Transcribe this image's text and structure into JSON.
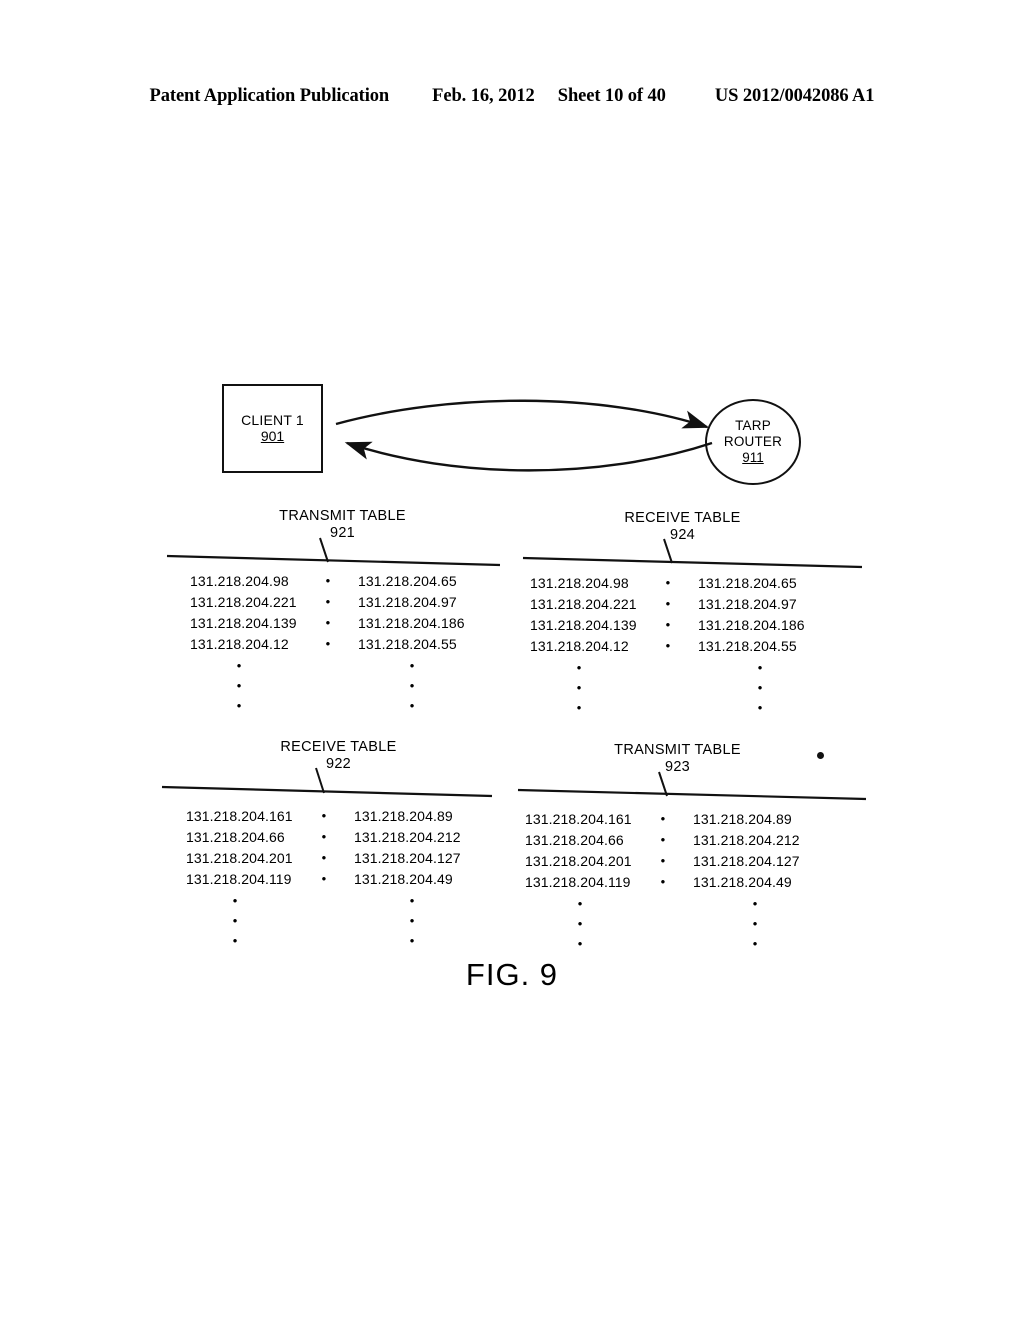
{
  "header": {
    "publication": "Patent Application Publication",
    "date": "Feb. 16, 2012",
    "sheet": "Sheet 10 of 40",
    "patent_number": "US 2012/0042086 A1"
  },
  "figure": {
    "caption": "FIG. 9",
    "nodes": {
      "client": {
        "label": "CLIENT 1",
        "ref": "901"
      },
      "router": {
        "label_line1": "TARP",
        "label_line2": "ROUTER",
        "ref": "911"
      }
    },
    "link_dots": "•",
    "ellipsis_dot": "•",
    "tables": [
      {
        "id": "transmit-table-921",
        "title": "TRANSMIT TABLE",
        "ref": "921",
        "rows": [
          {
            "left": "131.218.204.98",
            "right": "131.218.204.65"
          },
          {
            "left": "131.218.204.221",
            "right": "131.218.204.97"
          },
          {
            "left": "131.218.204.139",
            "right": "131.218.204.186"
          },
          {
            "left": "131.218.204.12",
            "right": "131.218.204.55"
          }
        ]
      },
      {
        "id": "receive-table-924",
        "title": "RECEIVE TABLE",
        "ref": "924",
        "rows": [
          {
            "left": "131.218.204.98",
            "right": "131.218.204.65"
          },
          {
            "left": "131.218.204.221",
            "right": "131.218.204.97"
          },
          {
            "left": "131.218.204.139",
            "right": "131.218.204.186"
          },
          {
            "left": "131.218.204.12",
            "right": "131.218.204.55"
          }
        ]
      },
      {
        "id": "receive-table-922",
        "title": "RECEIVE TABLE",
        "ref": "922",
        "rows": [
          {
            "left": "131.218.204.161",
            "right": "131.218.204.89"
          },
          {
            "left": "131.218.204.66",
            "right": "131.218.204.212"
          },
          {
            "left": "131.218.204.201",
            "right": "131.218.204.127"
          },
          {
            "left": "131.218.204.119",
            "right": "131.218.204.49"
          }
        ]
      },
      {
        "id": "transmit-table-923",
        "title": "TRANSMIT TABLE",
        "ref": "923",
        "rows": [
          {
            "left": "131.218.204.161",
            "right": "131.218.204.89"
          },
          {
            "left": "131.218.204.66",
            "right": "131.218.204.212"
          },
          {
            "left": "131.218.204.201",
            "right": "131.218.204.127"
          },
          {
            "left": "131.218.204.119",
            "right": "131.218.204.49"
          }
        ]
      }
    ]
  },
  "colors": {
    "ink": "#111111",
    "page": "#ffffff"
  }
}
